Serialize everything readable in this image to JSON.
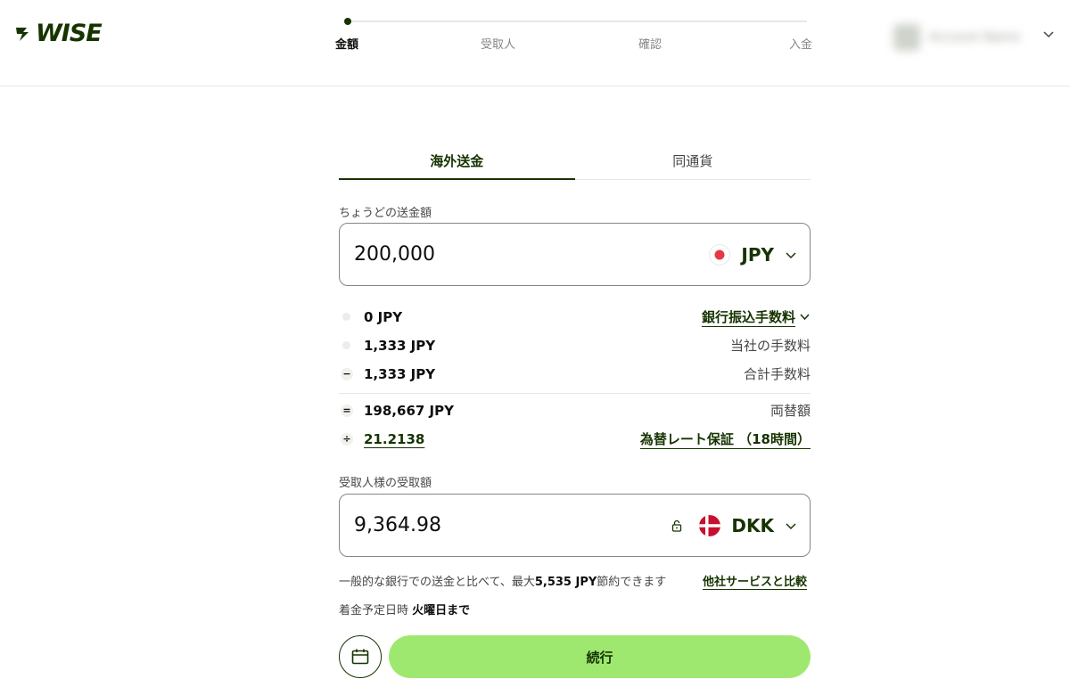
{
  "header": {
    "logo_text": "WISE",
    "steps": [
      {
        "label": "金額",
        "active": true
      },
      {
        "label": "受取人",
        "active": false
      },
      {
        "label": "確認",
        "active": false
      },
      {
        "label": "入金",
        "active": false
      }
    ],
    "account_name": "Account Name"
  },
  "tabs": [
    {
      "label": "海外送金",
      "active": true
    },
    {
      "label": "同通貨",
      "active": false
    }
  ],
  "send": {
    "label": "ちょうどの送金額",
    "amount": "200,000",
    "currency": "JPY"
  },
  "fees": {
    "bank_fee_amount": "0 JPY",
    "bank_fee_label": "銀行振込手数料",
    "our_fee_amount": "1,333 JPY",
    "our_fee_label": "当社の手数料",
    "total_fee_amount": "1,333 JPY",
    "total_fee_label": "合計手数料",
    "converted_amount": "198,667 JPY",
    "converted_label": "両替額",
    "rate": "21.2138",
    "rate_label": "為替レート保証 （18時間）"
  },
  "receive": {
    "label": "受取人様の受取額",
    "amount": "9,364.98",
    "currency": "DKK"
  },
  "savings": {
    "prefix": "一般的な銀行での送金と比べて、最大",
    "amount": "5,535 JPY",
    "suffix": "節約できます",
    "compare_link": "他社サービスと比較"
  },
  "arrival": {
    "label": "着金予定日時",
    "value": "火曜日まで"
  },
  "continue_label": "続行",
  "colors": {
    "brand_dark": "#163300",
    "brand_green": "#9fe870",
    "jp_red": "#e63946",
    "dk_red": "#c8102e"
  }
}
